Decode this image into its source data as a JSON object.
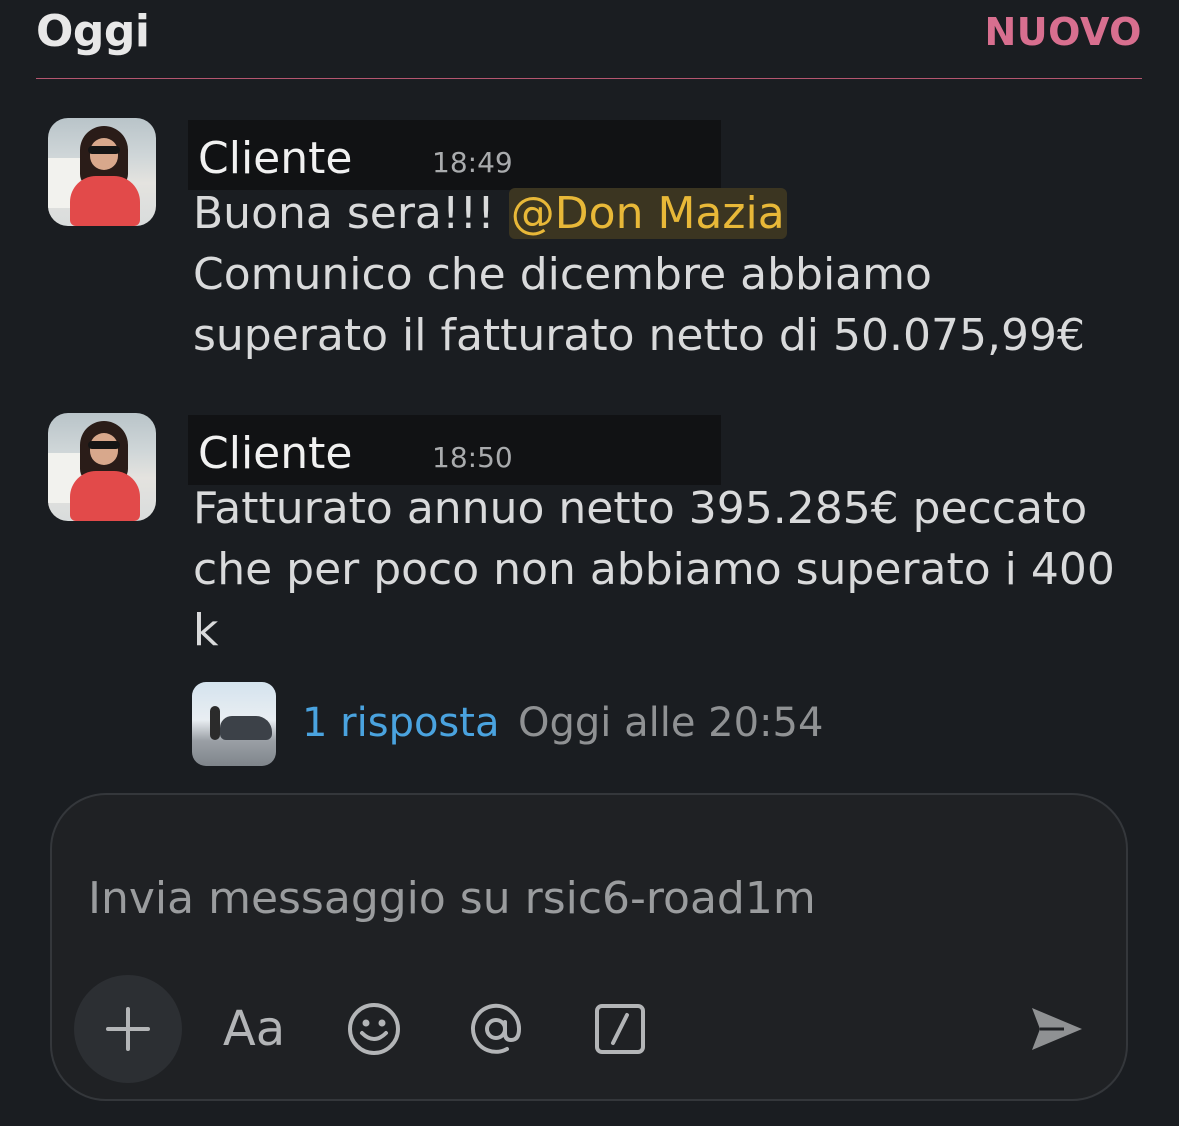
{
  "header": {
    "title": "Oggi",
    "new_label": "NUOVO"
  },
  "messages": [
    {
      "author": "Cliente",
      "time": "18:49",
      "line1_prefix": "Buona sera!!! ",
      "mention": "@Don Mazia",
      "line2": "Comunico che dicembre abbiamo",
      "line3": "superato il fatturato netto di 50.075,99€"
    },
    {
      "author": "Cliente",
      "time": "18:50",
      "line1": "Fatturato annuo netto 395.285€ peccato",
      "line2": "che per poco non abbiamo superato i 400",
      "line3": "k"
    }
  ],
  "thread": {
    "reply_count": "1 risposta",
    "reply_time": "Oggi alle 20:54"
  },
  "composer": {
    "placeholder": "Invia messaggio su rsic6-road1m",
    "format_label": "Aa"
  },
  "colors": {
    "accent_new": "#d86f8f",
    "mention_fg": "#e8b838",
    "link": "#4aa3df"
  }
}
